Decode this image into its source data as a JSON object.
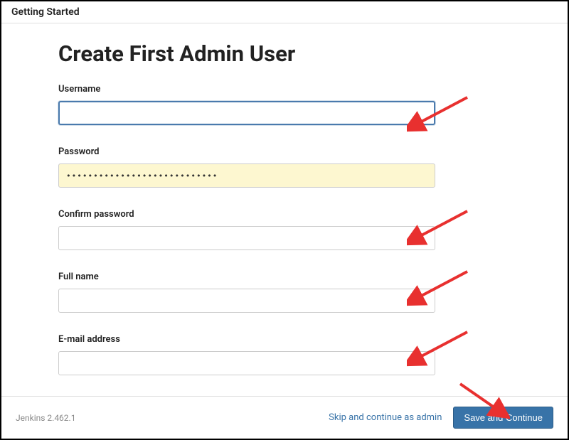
{
  "header": {
    "title": "Getting Started"
  },
  "page": {
    "title": "Create First Admin User"
  },
  "form": {
    "username": {
      "label": "Username",
      "value": ""
    },
    "password": {
      "label": "Password",
      "value": "••••••••••••••••••••••••••••"
    },
    "confirm_password": {
      "label": "Confirm password",
      "value": ""
    },
    "full_name": {
      "label": "Full name",
      "value": ""
    },
    "email": {
      "label": "E-mail address",
      "value": ""
    }
  },
  "footer": {
    "version": "Jenkins 2.462.1",
    "skip_label": "Skip and continue as admin",
    "save_label": "Save and Continue"
  },
  "annotations": {
    "arrow_color": "#e8302f"
  }
}
